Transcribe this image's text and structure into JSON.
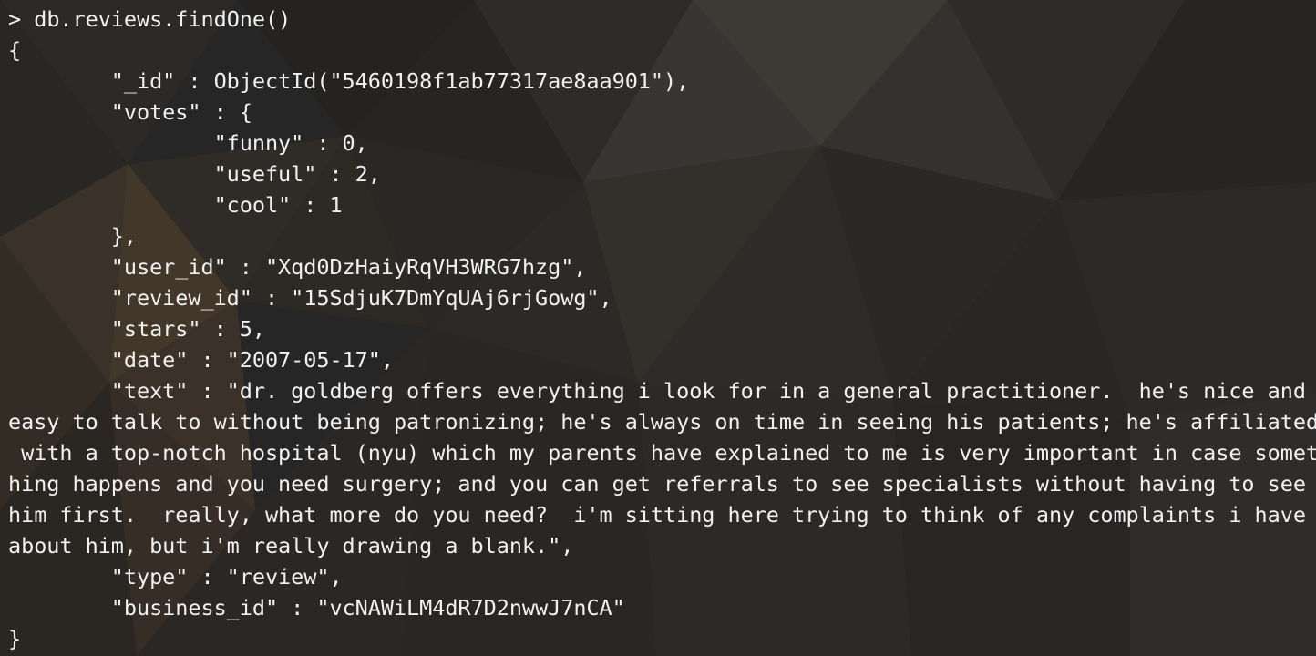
{
  "terminal": {
    "prompt": ">",
    "command": "db.reviews.findOne()",
    "lines": [
      "{",
      "        \"_id\" : ObjectId(\"5460198f1ab77317ae8aa901\"),",
      "        \"votes\" : {",
      "                \"funny\" : 0,",
      "                \"useful\" : 2,",
      "                \"cool\" : 1",
      "        },",
      "        \"user_id\" : \"Xqd0DzHaiyRqVH3WRG7hzg\",",
      "        \"review_id\" : \"15SdjuK7DmYqUAj6rjGowg\",",
      "        \"stars\" : 5,",
      "        \"date\" : \"2007-05-17\",",
      "        \"text\" : \"dr. goldberg offers everything i look for in a general practitioner.  he's nice and",
      "easy to talk to without being patronizing; he's always on time in seeing his patients; he's affiliated",
      " with a top-notch hospital (nyu) which my parents have explained to me is very important in case somet",
      "hing happens and you need surgery; and you can get referrals to see specialists without having to see",
      "him first.  really, what more do you need?  i'm sitting here trying to think of any complaints i have",
      "about him, but i'm really drawing a blank.\",",
      "        \"type\" : \"review\",",
      "        \"business_id\" : \"vcNAWiLM4dR7D2nwwJ7nCA\"",
      "}"
    ]
  },
  "colors": {
    "background": "#262626",
    "text": "#f0f0f0"
  }
}
